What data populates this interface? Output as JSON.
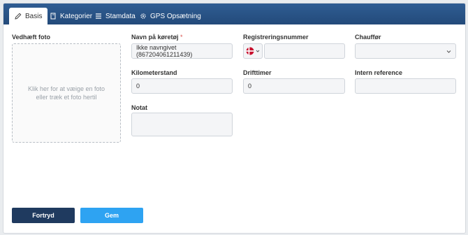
{
  "tabs": [
    {
      "label": "Basis",
      "icon": "pencil-icon",
      "active": true
    },
    {
      "label": "Kategorier",
      "icon": "book-icon",
      "active": false
    },
    {
      "label": "Stamdata",
      "icon": "list-icon",
      "active": false
    },
    {
      "label": "GPS Opsætning",
      "icon": "gear-icon",
      "active": false
    }
  ],
  "photo": {
    "label": "Vedhæft foto",
    "hint": "Klik her for at væige en foto eller træk et foto hertil"
  },
  "fields": {
    "vehicle_name": {
      "label": "Navn på køretøj",
      "required_mark": "*",
      "value": "Ikke navngivet (867204061211439)"
    },
    "registration": {
      "label": "Registreringsnummer",
      "value": "",
      "country_flag": "denmark-flag-icon"
    },
    "driver": {
      "label": "Chauffør",
      "value": ""
    },
    "mileage": {
      "label": "Kilometerstand",
      "value": "0"
    },
    "operating_hours": {
      "label": "Drifttimer",
      "value": "0"
    },
    "internal_reference": {
      "label": "Intern reference",
      "value": ""
    },
    "note": {
      "label": "Notat",
      "value": ""
    }
  },
  "buttons": {
    "cancel": "Fortryd",
    "save": "Gem"
  },
  "colors": {
    "tabbar": "#2f5d93",
    "cancel_button": "#1f3a5f",
    "save_button": "#2ea3f2",
    "required": "#d9534f"
  }
}
